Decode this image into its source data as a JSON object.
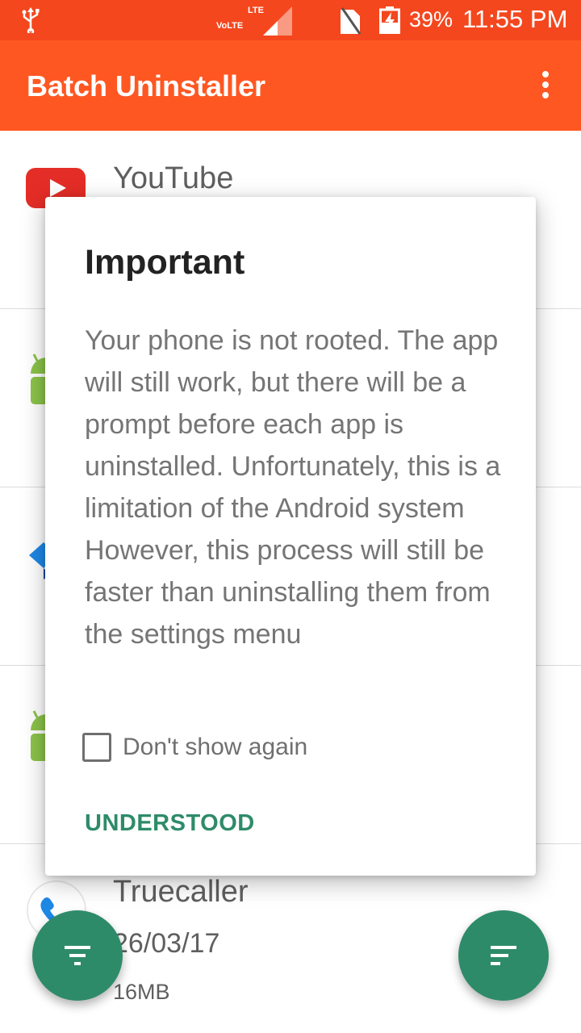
{
  "status_bar": {
    "volte": "VoLTE",
    "lte": "LTE",
    "battery_percent": "39%",
    "time": "11:55 PM",
    "icons": [
      "usb-icon",
      "signal-icon",
      "no-sim-icon",
      "battery-charging-icon"
    ]
  },
  "app_bar": {
    "title": "Batch Uninstaller",
    "menu_icon": "more-vert-icon"
  },
  "apps": [
    {
      "name": "YouTube",
      "icon": "youtube-icon"
    },
    {
      "name": "",
      "icon": "android-icon"
    },
    {
      "name": "",
      "icon": "dropbox-icon"
    },
    {
      "name": "",
      "icon": "android-icon"
    },
    {
      "name": "Truecaller",
      "date": "26/03/17",
      "size": "16MB",
      "icon": "truecaller-icon"
    }
  ],
  "dialog": {
    "title": "Important",
    "message": "Your phone is not rooted. The app will still work, but there will be a prompt before each app is uninstalled. Unfortunately, this is a limitation of the Android system However, this process will still be faster than uninstalling them from the settings menu",
    "checkbox_label": "Don't show again",
    "checkbox_checked": false,
    "button_label": "UNDERSTOOD"
  },
  "fabs": {
    "left_icon": "filter-icon",
    "right_icon": "sort-icon"
  },
  "colors": {
    "status_bar": "#f4471e",
    "app_bar": "#ff5722",
    "accent": "#2e8b69"
  }
}
